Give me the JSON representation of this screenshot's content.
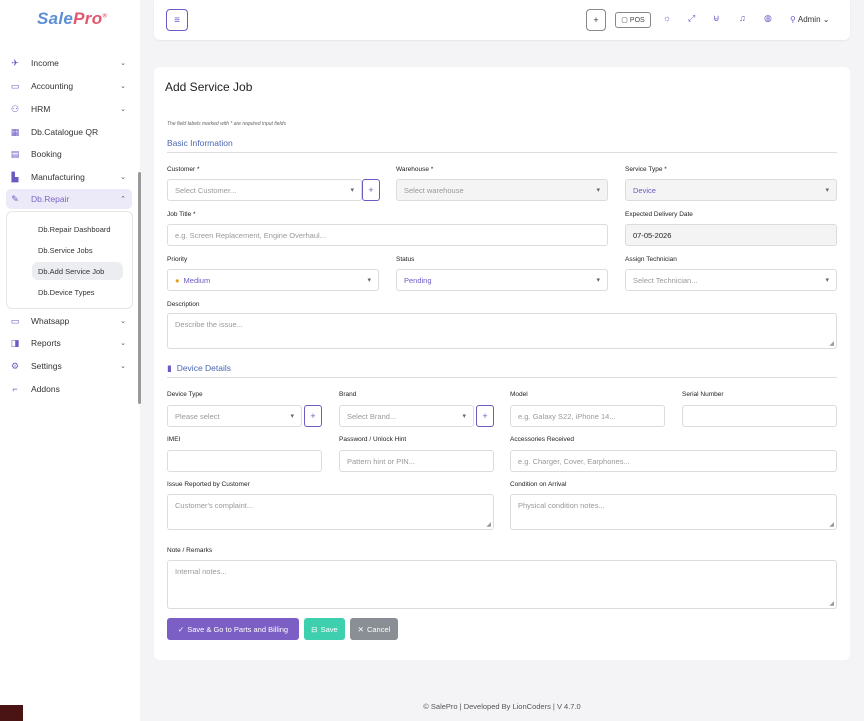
{
  "brand": {
    "name_part1": "Sale",
    "name_part2": "Pro",
    "mark": "®"
  },
  "sidebar": {
    "items": [
      {
        "label": "Income",
        "icon": "rocket-icon"
      },
      {
        "label": "Accounting",
        "icon": "briefcase-icon"
      },
      {
        "label": "HRM",
        "icon": "users-icon"
      },
      {
        "label": "Db.Catalogue QR",
        "icon": "qr-icon"
      },
      {
        "label": "Booking",
        "icon": "calendar-icon"
      },
      {
        "label": "Manufacturing",
        "icon": "factory-icon"
      },
      {
        "label": "Db.Repair",
        "icon": "wrench-icon"
      },
      {
        "label": "Whatsapp",
        "icon": "monitor-icon"
      },
      {
        "label": "Reports",
        "icon": "report-icon"
      },
      {
        "label": "Settings",
        "icon": "gear-icon"
      },
      {
        "label": "Addons",
        "icon": "plug-icon"
      }
    ],
    "submenu": [
      "Db.Repair Dashboard",
      "Db.Service Jobs",
      "Db.Add Service Job",
      "Db.Device Types"
    ]
  },
  "topbar": {
    "plus": "+",
    "pos_label": "POS",
    "user": "Admin"
  },
  "form": {
    "title": "Add Service Job",
    "note": "The field labels marked with * are required input fields",
    "basic_section": "Basic Information",
    "customer_label": "Customer *",
    "customer_placeholder": "Select Customer...",
    "warehouse_label": "Warehouse *",
    "warehouse_placeholder": "Select warehouse",
    "service_type_label": "Service Type *",
    "service_type_value": "Device",
    "job_title_label": "Job Title *",
    "job_title_placeholder": "e.g. Screen Replacement, Engine Overhaul...",
    "delivery_label": "Expected Delivery Date",
    "delivery_value": "07-05-2026",
    "priority_label": "Priority",
    "priority_value": "Medium",
    "status_label": "Status",
    "status_value": "Pending",
    "technician_label": "Assign Technician",
    "technician_placeholder": "Select Technician...",
    "description_label": "Description",
    "description_placeholder": "Describe the issue...",
    "device_section": "Device Details",
    "device_type_label": "Device Type",
    "device_type_placeholder": "Please select",
    "brand_label": "Brand",
    "brand_placeholder": "Select Brand...",
    "model_label": "Model",
    "model_placeholder": "e.g. Galaxy S22, iPhone 14...",
    "serial_label": "Serial Number",
    "imei_label": "IMEI",
    "password_label": "Password / Unlock Hint",
    "password_placeholder": "Pattern hint or PIN...",
    "accessories_label": "Accessories Received",
    "accessories_placeholder": "e.g. Charger, Cover, Earphones...",
    "issue_label": "Issue Reported by Customer",
    "issue_placeholder": "Customer's complaint...",
    "condition_label": "Condition on Arrival",
    "condition_placeholder": "Physical condition notes...",
    "remarks_label": "Note / Remarks",
    "remarks_placeholder": "Internal notes...",
    "btn_save_billing": "Save & Go to Parts and Billing",
    "btn_save": "Save",
    "btn_cancel": "Cancel"
  },
  "footer": "© SalePro | Developed By LionCoders | V 4.7.0",
  "colors": {
    "primary": "#7b5fc4",
    "success": "#3ecfae",
    "secondary": "#8a8f95",
    "link": "#4a66b0"
  }
}
